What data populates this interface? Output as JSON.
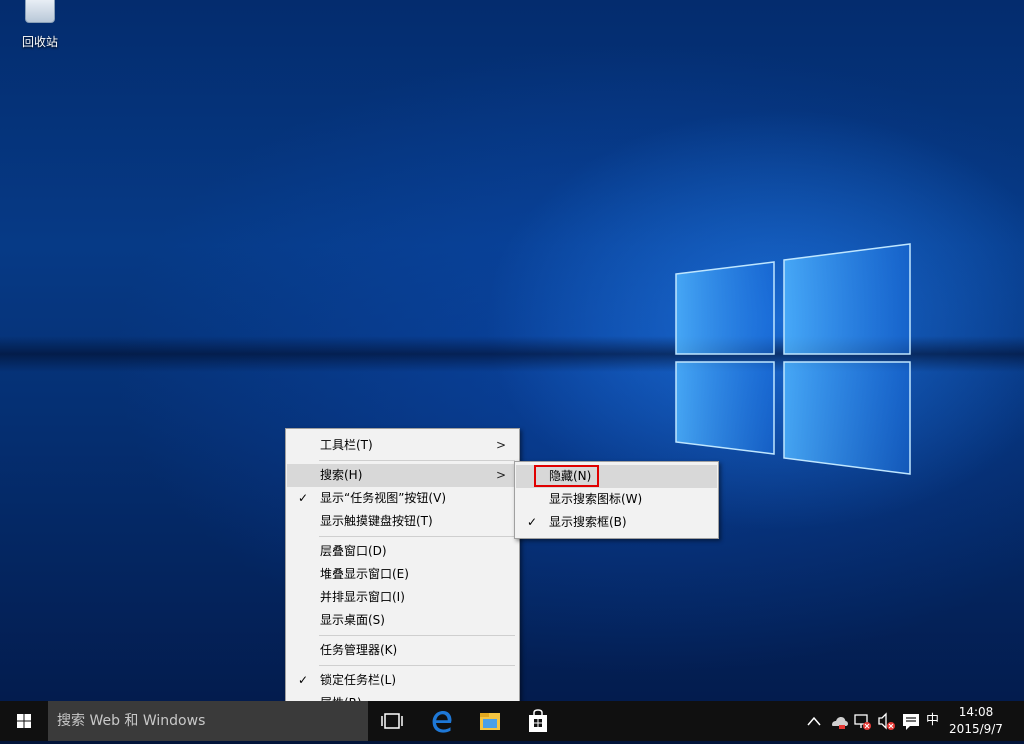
{
  "desktop": {
    "recycle_bin_label": "回收站"
  },
  "context_menu": {
    "items": [
      {
        "label": "工具栏(T)",
        "checked": false,
        "submenu": true
      },
      {
        "label": "搜索(H)",
        "checked": false,
        "submenu": true
      },
      {
        "label": "显示“任务视图”按钮(V)",
        "checked": true
      },
      {
        "label": "显示触摸键盘按钮(T)",
        "checked": false
      },
      {
        "label": "层叠窗口(D)"
      },
      {
        "label": "堆叠显示窗口(E)"
      },
      {
        "label": "并排显示窗口(I)"
      },
      {
        "label": "显示桌面(S)"
      },
      {
        "label": "任务管理器(K)"
      },
      {
        "label": "锁定任务栏(L)",
        "checked": true
      },
      {
        "label": "属性(R)"
      }
    ],
    "check_glyph": "✓",
    "arrow_glyph": ">"
  },
  "search_submenu": {
    "items": [
      {
        "label": "隐藏(N)",
        "checked": false
      },
      {
        "label": "显示搜索图标(W)",
        "checked": false
      },
      {
        "label": "显示搜索框(B)",
        "checked": true
      }
    ]
  },
  "taskbar": {
    "search_placeholder": "搜索 Web 和 Windows",
    "input_indicator": "中",
    "time": "14:08",
    "date": "2015/9/7",
    "icons": [
      "start-icon",
      "task-view-icon",
      "edge-icon",
      "file-explorer-icon",
      "store-icon"
    ],
    "tray_icons": [
      "chevron-up-icon",
      "onedrive-icon",
      "network-icon",
      "volume-icon",
      "action-center-icon"
    ]
  },
  "colors": {
    "menu_bg": "#f2f2f2",
    "menu_hover": "#d8d8d8",
    "highlight_box": "#e00000",
    "taskbar_bg": "#101010",
    "search_bg": "#3a3a3a",
    "edge_blue": "#1e78d7"
  }
}
